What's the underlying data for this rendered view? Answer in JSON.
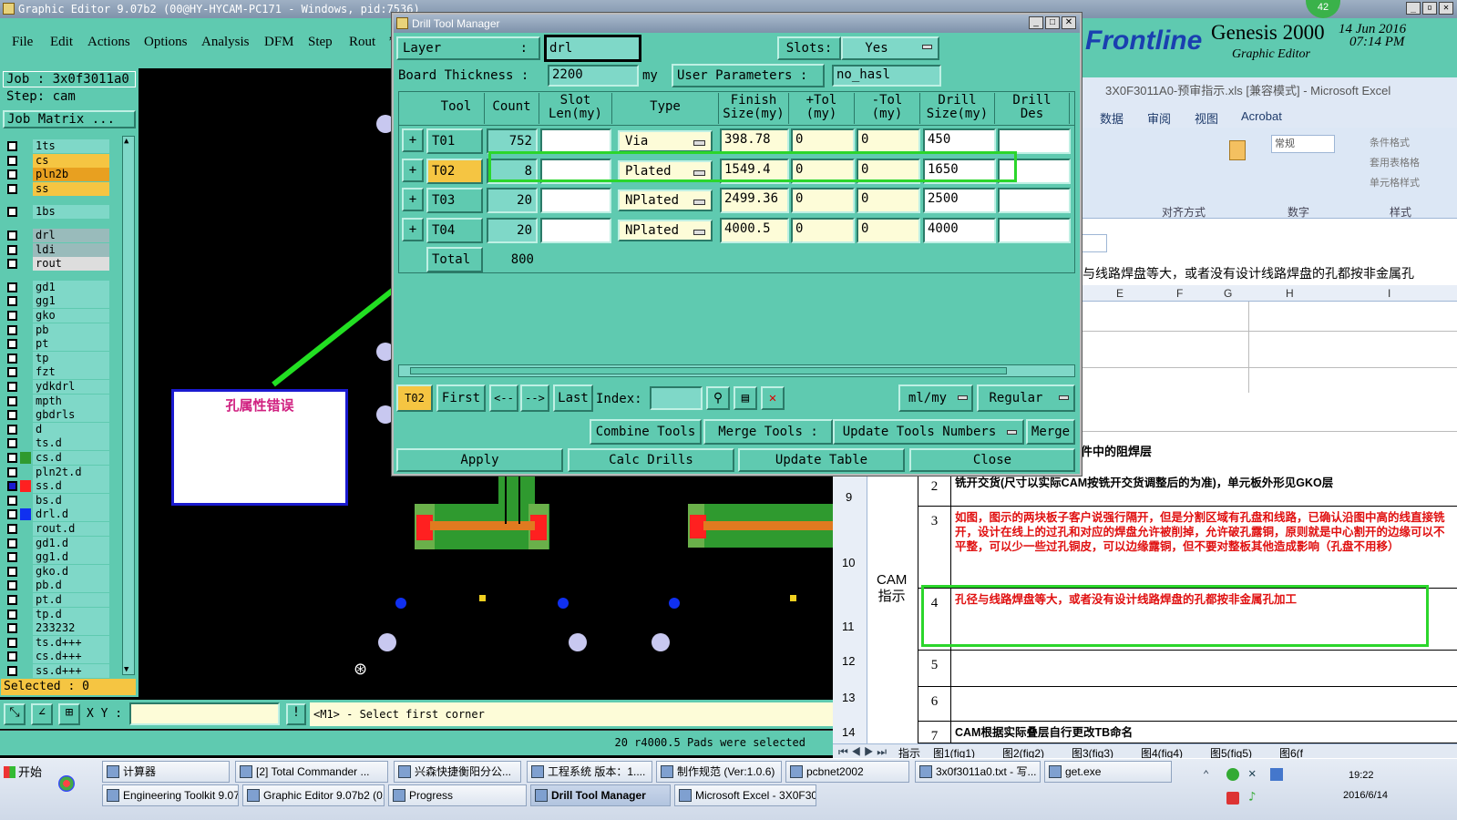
{
  "window": {
    "title": "Graphic Editor 9.07b2 (00@HY-HYCAM-PC171 - Windows, pid:7536)"
  },
  "menubar": {
    "items": [
      "File",
      "Edit",
      "Actions",
      "Options",
      "Analysis",
      "DFM",
      "Step",
      "Rout",
      "’"
    ]
  },
  "left": {
    "job": "Job : 3x0f3011a0",
    "step": "Step: cam",
    "job_matrix": "Job Matrix ...",
    "layers": [
      "1ts",
      "cs",
      "pln2b",
      "ss",
      "1bs",
      "drl",
      "ldi",
      "rout",
      "gd1",
      "gg1",
      "gko",
      "pb",
      "pt",
      "tp",
      "fzt",
      "ydkdrl",
      "mpth",
      "gbdrls",
      "d",
      "ts.d",
      "cs.d",
      "pln2t.d",
      "ss.d",
      "bs.d",
      "drl.d",
      "rout.d",
      "gd1.d",
      "gg1.d",
      "gko.d",
      "pb.d",
      "pt.d",
      "tp.d",
      "233232",
      "ts.d+++",
      "cs.d+++",
      "ss.d+++"
    ],
    "selected": "Selected : 0"
  },
  "bottom": {
    "xy_label": "X Y :",
    "xy_value": "",
    "alert": "!",
    "prompt": "<M1> - Select first corner",
    "status": "20 r4000.5 Pads were selected"
  },
  "annotation": {
    "text": "孔属性错误"
  },
  "genesis": {
    "brand": "Frontline",
    "product": "Genesis 2000",
    "sub": "Graphic Editor",
    "date": "14 Jun 2016",
    "time": "07:14 PM",
    "badge": "42"
  },
  "dialog": {
    "title": "Drill Tool Manager",
    "layer_label": "Layer",
    "layer_value": "drl",
    "slots_label": "Slots:",
    "slots_value": "Yes",
    "thickness_label": "Board Thickness :",
    "thickness_value": "2200",
    "thickness_unit": "my",
    "user_params_label": "User Parameters :",
    "user_params_value": "no_hasl",
    "headers": [
      "Tool",
      "Count",
      "Slot\nLen(my)",
      "Type",
      "Finish\nSize(my)",
      "+Tol\n(my)",
      "-Tol\n(my)",
      "Drill\nSize(my)",
      "Drill\nDes"
    ],
    "rows": [
      {
        "tool": "T01",
        "count": "752",
        "slot": "",
        "type": "Via",
        "finish": "398.78",
        "ptol": "0",
        "ntol": "0",
        "drill": "450",
        "des": ""
      },
      {
        "tool": "T02",
        "count": "8",
        "slot": "",
        "type": "Plated",
        "finish": "1549.4",
        "ptol": "0",
        "ntol": "0",
        "drill": "1650",
        "des": ""
      },
      {
        "tool": "T03",
        "count": "20",
        "slot": "",
        "type": "NPlated",
        "finish": "2499.36",
        "ptol": "0",
        "ntol": "0",
        "drill": "2500",
        "des": ""
      },
      {
        "tool": "T04",
        "count": "20",
        "slot": "",
        "type": "NPlated",
        "finish": "4000.5",
        "ptol": "0",
        "ntol": "0",
        "drill": "4000",
        "des": ""
      }
    ],
    "total_label": "Total",
    "total_count": "800",
    "nav_current": "T02",
    "nav_first": "First",
    "nav_prev": "<--",
    "nav_next": "-->",
    "nav_last": "Last",
    "index_label": "Index:",
    "index_value": "",
    "units": "ml/my",
    "mode": "Regular",
    "combine": "Combine Tools",
    "merge_tools": "Merge Tools :",
    "update_numbers": "Update Tools Numbers",
    "merge": "Merge",
    "apply": "Apply",
    "calc": "Calc Drills",
    "update_table": "Update Table",
    "close": "Close"
  },
  "excel": {
    "title": "3X0F3011A0-预审指示.xls [兼容模式] - Microsoft Excel",
    "tabs": [
      "数据",
      "审阅",
      "视图",
      "Acrobat"
    ],
    "ribbon_format": "常规",
    "ribbon_cond": "条件格式",
    "ribbon_table": "套用表格格",
    "ribbon_cell": "单元格样式",
    "group_align": "对齐方式",
    "group_number": "数字",
    "group_style": "样式",
    "formula_text": "与线路焊盘等大，或者没有设计线路焊盘的孔都按非金属孔",
    "cols": [
      "E",
      "F",
      "G",
      "H",
      "I"
    ],
    "row_hdrs": [
      "9",
      "10",
      "11",
      "12",
      "13",
      "14"
    ],
    "cam_label": "CAM\n指示",
    "partial_text": "件中的阻焊层",
    "items": [
      {
        "no": "2",
        "text": "铣开交货(尺寸以实际CAM按铣开交货调整后的为准)，单元板外形见GKO层"
      },
      {
        "no": "3",
        "text": "如图，图示的两块板子客户说强行隔开，但是分割区域有孔盘和线路，已确认沿图中高的线直接铣开，设计在线上的过孔和对应的焊盘允许被削掉，允许破孔露铜，原则就是中心割开的边缘可以不平整，可以少一些过孔铜皮，可以边缘露铜，但不要对整板其他造成影响（孔盘不用移）"
      },
      {
        "no": "4",
        "text": "孔径与线路焊盘等大，或者没有设计线路焊盘的孔都按非金属孔加工"
      },
      {
        "no": "5",
        "text": ""
      },
      {
        "no": "6",
        "text": ""
      },
      {
        "no": "7",
        "text": "CAM根据实际叠层自行更改TB命名"
      }
    ],
    "sheets": [
      "指示",
      "图1(fig1)",
      "图2(fig2)",
      "图3(fig3)",
      "图4(fig4)",
      "图5(fig5)",
      "图6(f"
    ]
  },
  "taskbar": {
    "start": "开始",
    "row1": [
      "计算器",
      "[2] Total Commander ...",
      "兴森快捷衡阳分公...",
      "工程系统 版本：1....",
      "制作规范 (Ver:1.0.6)",
      "pcbnet2002",
      "3x0f3011a0.txt - 写...",
      "get.exe"
    ],
    "row2": [
      "Engineering Toolkit 9.07...",
      "Graphic Editor 9.07b2 (0...",
      "Progress",
      "Drill Tool Manager",
      "Microsoft Excel - 3X0F30..."
    ],
    "time": "19:22",
    "date": "2016/6/14"
  }
}
